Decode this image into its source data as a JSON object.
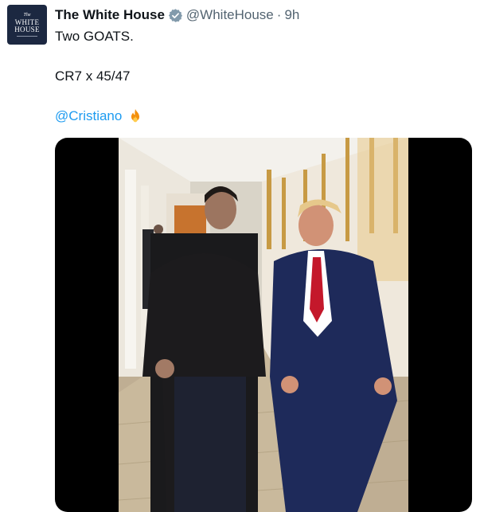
{
  "tweet": {
    "author_name": "The White House",
    "handle": "@WhiteHouse",
    "separator": "·",
    "time": "9h",
    "text_line1": "Two GOATS.",
    "text_line2": "CR7 x 45/47",
    "mention": "@Cristiano",
    "emoji_icon": "fire-icon",
    "avatar": {
      "line_small": "The",
      "line1": "WHITE",
      "line2": "HOUSE"
    },
    "verified_icon": "verified-badge-icon"
  },
  "colors": {
    "link": "#1d9bf0",
    "secondary_text": "#536471",
    "avatar_bg": "#1c2841",
    "verified_badge": "#829aab"
  }
}
